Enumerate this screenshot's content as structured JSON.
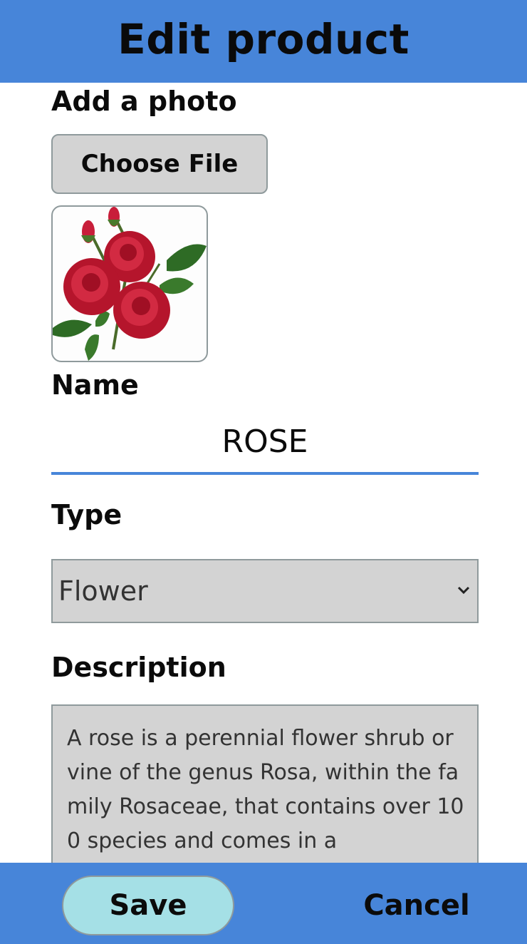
{
  "header": {
    "title": "Edit product"
  },
  "photo": {
    "label": "Add a photo",
    "choose_file_label": "Choose File",
    "preview_icon": "rose-flower-image"
  },
  "name": {
    "label": "Name",
    "value": "ROSE"
  },
  "type": {
    "label": "Type",
    "selected": "Flower"
  },
  "description": {
    "label": "Description",
    "value": "A rose is a perennial flower shrub or vine of the genus Rosa, within the family Rosaceae, that contains over 100 species and comes in a"
  },
  "footer": {
    "save_label": "Save",
    "cancel_label": "Cancel"
  },
  "colors": {
    "bar": "#4785d9",
    "field_bg": "#d3d3d3",
    "save_bg": "#a5e0e6",
    "underline": "#4785d9"
  }
}
